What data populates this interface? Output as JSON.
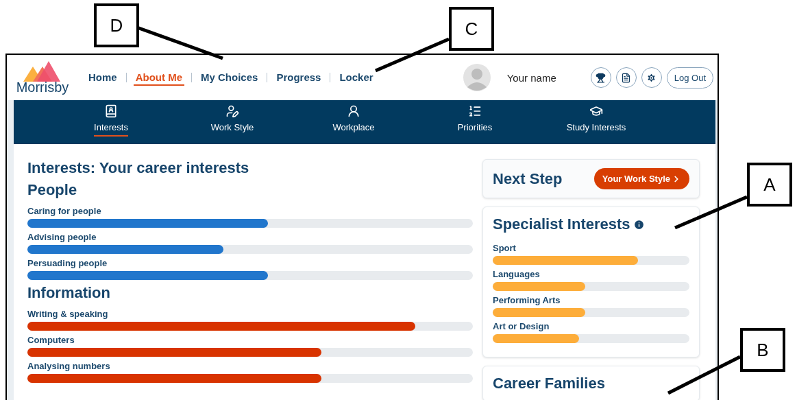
{
  "callouts": [
    {
      "label": "D"
    },
    {
      "label": "C"
    },
    {
      "label": "A"
    },
    {
      "label": "B"
    }
  ],
  "header": {
    "logo": "Morrisby",
    "user_name": "Your name",
    "logout": "Log Out"
  },
  "nav": [
    {
      "label": "Home",
      "selected": false
    },
    {
      "label": "About Me",
      "selected": true
    },
    {
      "label": "My Choices",
      "selected": false
    },
    {
      "label": "Progress",
      "selected": false
    },
    {
      "label": "Locker",
      "selected": false
    }
  ],
  "subnav": [
    {
      "label": "Interests",
      "kind": "interests",
      "selected": true
    },
    {
      "label": "Work Style",
      "kind": "workstyle",
      "selected": false
    },
    {
      "label": "Workplace",
      "kind": "workplace",
      "selected": false
    },
    {
      "label": "Priorities",
      "kind": "priorities",
      "selected": false
    },
    {
      "label": "Study Interests",
      "kind": "study",
      "selected": false
    }
  ],
  "title": "Interests: Your career interests",
  "groups": [
    {
      "name": "People",
      "color": "#2176cc",
      "items": [
        {
          "label": "Caring for people",
          "level": 0.54
        },
        {
          "label": "Advising people",
          "level": 0.44
        },
        {
          "label": "Persuading people",
          "level": 0.54
        }
      ]
    },
    {
      "name": "Information",
      "color": "#d83300",
      "items": [
        {
          "label": "Writing & speaking",
          "level": 0.87
        },
        {
          "label": "Computers",
          "level": 0.66
        },
        {
          "label": "Analysing numbers",
          "level": 0.66
        }
      ]
    }
  ],
  "next_step": {
    "title": "Next Step",
    "button": "Your Work Style"
  },
  "specialist": {
    "title": "Specialist Interests",
    "items": [
      {
        "label": "Sport",
        "level": 0.74
      },
      {
        "label": "Languages",
        "level": 0.47
      },
      {
        "label": "Performing Arts",
        "level": 0.47
      },
      {
        "label": "Art or Design",
        "level": 0.44
      }
    ]
  },
  "career_families": {
    "title": "Career Families"
  }
}
